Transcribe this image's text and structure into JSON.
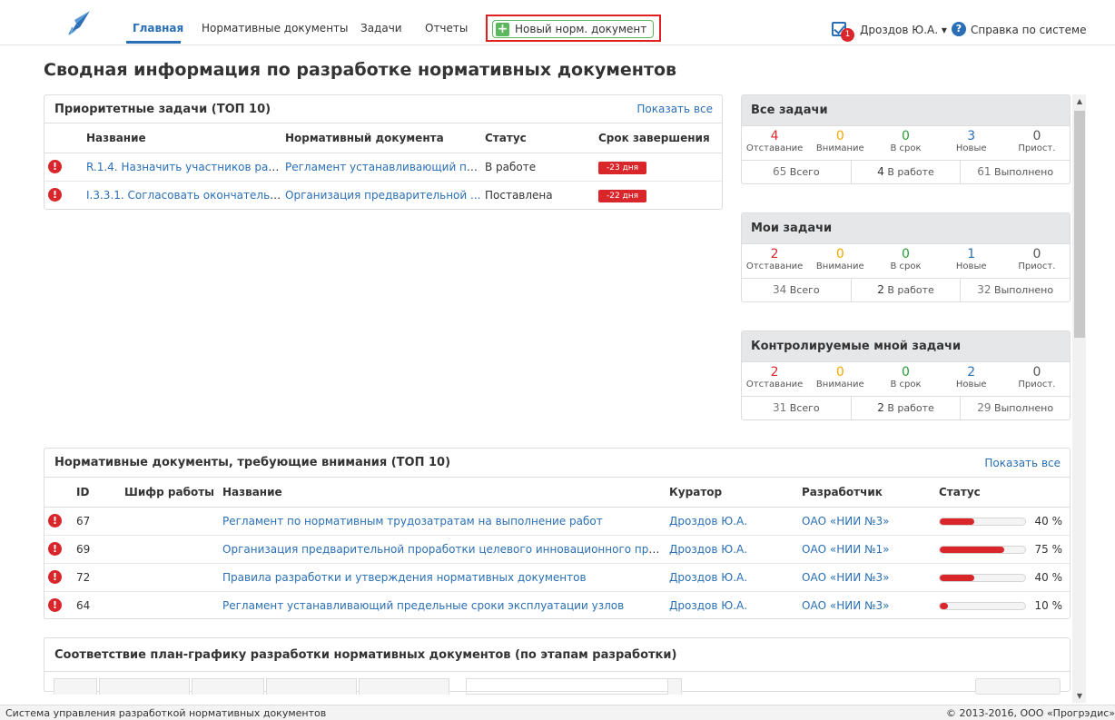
{
  "nav": {
    "items": [
      {
        "label": "Главная",
        "active": true
      },
      {
        "label": "Нормативные документы",
        "active": false
      },
      {
        "label": "Задачи",
        "active": false
      },
      {
        "label": "Отчеты",
        "active": false
      }
    ],
    "new_doc_label": "Новый норм. документ",
    "notifications_count": "1",
    "user_name": "Дроздов Ю.А. ▾",
    "help_label": "Справка по системе"
  },
  "page_title": "Сводная информация по разработке нормативных документов",
  "priority_tasks": {
    "title": "Приоритетные задачи (ТОП 10)",
    "show_all": "Показать все",
    "columns": [
      "Название",
      "Нормативный документа",
      "Статус",
      "Срок завершения"
    ],
    "rows": [
      {
        "name": "R.1.4. Назначить участников раз...",
        "doc": "Регламент устанавливающий пр...",
        "status": "В работе",
        "deadline": "-23 дня"
      },
      {
        "name": "I.3.3.1. Согласовать окончательн...",
        "doc": "Организация предварительной ...",
        "status": "Поставлена",
        "deadline": "-22 дня"
      }
    ]
  },
  "stats": [
    {
      "title": "Все задачи",
      "counts": [
        {
          "value": "4",
          "label": "Отставание"
        },
        {
          "value": "0",
          "label": "Внимание"
        },
        {
          "value": "0",
          "label": "В срок"
        },
        {
          "value": "3",
          "label": "Новые"
        },
        {
          "value": "0",
          "label": "Приост."
        }
      ],
      "totals": {
        "total_num": "65",
        "total_lbl": "Всего",
        "work_num": "4",
        "work_lbl": "В работе",
        "done_num": "61",
        "done_lbl": "Выполнено"
      }
    },
    {
      "title": "Мои задачи",
      "counts": [
        {
          "value": "2",
          "label": "Отставание"
        },
        {
          "value": "0",
          "label": "Внимание"
        },
        {
          "value": "0",
          "label": "В срок"
        },
        {
          "value": "1",
          "label": "Новые"
        },
        {
          "value": "0",
          "label": "Приост."
        }
      ],
      "totals": {
        "total_num": "34",
        "total_lbl": "Всего",
        "work_num": "2",
        "work_lbl": "В работе",
        "done_num": "32",
        "done_lbl": "Выполнено"
      }
    },
    {
      "title": "Контролируемые мной задачи",
      "counts": [
        {
          "value": "2",
          "label": "Отставание"
        },
        {
          "value": "0",
          "label": "Внимание"
        },
        {
          "value": "0",
          "label": "В срок"
        },
        {
          "value": "2",
          "label": "Новые"
        },
        {
          "value": "0",
          "label": "Приост."
        }
      ],
      "totals": {
        "total_num": "31",
        "total_lbl": "Всего",
        "work_num": "2",
        "work_lbl": "В работе",
        "done_num": "29",
        "done_lbl": "Выполнено"
      }
    }
  ],
  "attention_docs": {
    "title": "Нормативные документы, требующие внимания (ТОП 10)",
    "show_all": "Показать все",
    "columns": [
      "ID",
      "Шифр работы",
      "Название",
      "Куратор",
      "Разработчик",
      "Статус"
    ],
    "rows": [
      {
        "id": "67",
        "code": "",
        "name": "Регламент по нормативным трудозатратам на выполнение работ",
        "curator": "Дроздов Ю.А.",
        "developer": "ОАО «НИИ №3»",
        "progress": 40,
        "progress_label": "40 %"
      },
      {
        "id": "69",
        "code": "",
        "name": "Организация предварительной проработки целевого инновационного проек...",
        "curator": "Дроздов Ю.А.",
        "developer": "ОАО «НИИ №1»",
        "progress": 75,
        "progress_label": "75 %"
      },
      {
        "id": "72",
        "code": "",
        "name": "Правила разработки и утверждения нормативных документов",
        "curator": "Дроздов Ю.А.",
        "developer": "ОАО «НИИ №3»",
        "progress": 40,
        "progress_label": "40 %"
      },
      {
        "id": "64",
        "code": "",
        "name": "Регламент устанавливающий предельные сроки эксплуатации узлов",
        "curator": "Дроздов Ю.А.",
        "developer": "ОАО «НИИ №3»",
        "progress": 10,
        "progress_label": "10 %"
      }
    ]
  },
  "plan": {
    "title": "Соответствие план-графику разработки нормативных документов (по этапам разработки)"
  },
  "footer": {
    "left": "Система управления разработкой нормативных документов",
    "right": "© 2013-2016, ООО «Прогрэдис»"
  },
  "colors": {
    "accent": "#2a6fb6",
    "danger": "#d9262b",
    "success": "#5cb85c",
    "warning": "#f0a800",
    "ok": "#2a9d3a"
  }
}
